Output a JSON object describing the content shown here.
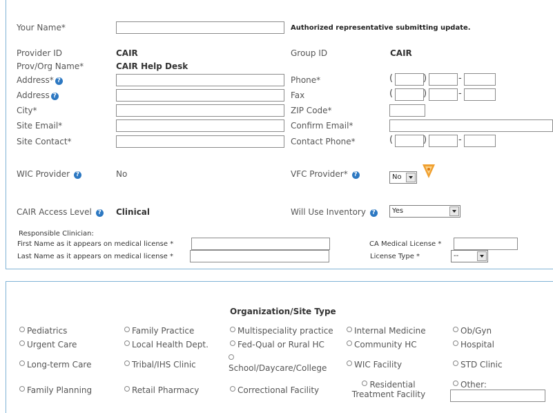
{
  "form": {
    "your_name": {
      "label": "Your Name*",
      "value": "",
      "note": "Authorized representative submitting update."
    },
    "provider_id": {
      "label": "Provider ID",
      "value": "CAIR"
    },
    "group_id": {
      "label": "Group ID",
      "value": "CAIR"
    },
    "prov_org_name": {
      "label": "Prov/Org Name*",
      "value": "CAIR Help Desk"
    },
    "address1": {
      "label": "Address*",
      "value": ""
    },
    "address2": {
      "label": "Address",
      "value": ""
    },
    "city": {
      "label": "City*",
      "value": ""
    },
    "site_email": {
      "label": "Site Email*",
      "value": ""
    },
    "site_contact": {
      "label": "Site Contact*",
      "value": ""
    },
    "phone": {
      "label": "Phone*",
      "open": "(",
      "close": ")",
      "dash": "-"
    },
    "fax": {
      "label": "Fax",
      "open": "(",
      "close": ")",
      "dash": "-"
    },
    "zip": {
      "label": "ZIP Code*",
      "value": ""
    },
    "confirm_email": {
      "label": "Confirm Email*",
      "value": ""
    },
    "contact_phone": {
      "label": "Contact Phone*",
      "open": "(",
      "close": ")",
      "dash": "-"
    },
    "wic_provider": {
      "label": "WIC Provider",
      "value": "No"
    },
    "vfc_provider": {
      "label": "VFC Provider*",
      "selected": "No"
    },
    "cair_access": {
      "label": "CAIR Access Level",
      "value": "Clinical"
    },
    "will_use_inventory": {
      "label": "Will Use Inventory",
      "selected": "Yes"
    },
    "clinician": {
      "heading": "Responsible Clinician:",
      "first_label": "First Name as it appears on medical license",
      "last_label": "Last Name as it appears on medical license",
      "star": "*",
      "license_label": "CA Medical License",
      "license_type_label": "License Type",
      "license_type_selected": "--"
    }
  },
  "help_glyph": "?",
  "vfc_icon": "shield-badge-icon",
  "org_site": {
    "title": "Organization/Site Type",
    "options": [
      "Pediatrics",
      "Family Practice",
      "Multispeciality practice",
      "Internal Medicine",
      "Ob/Gyn",
      "Urgent Care",
      "Local Health Dept.",
      "Fed-Qual or Rural HC",
      "Community HC",
      "Hospital",
      "Long-term Care",
      "Tribal/IHS Clinic",
      "School/Daycare/College",
      "WIC Facility",
      "STD Clinic",
      "Family Planning",
      "Retail Pharmacy",
      "Correctional Facility",
      "Residential Treatment Facility",
      "Other:"
    ],
    "other_value": ""
  },
  "colors": {
    "panel_border": "#7fb2d5",
    "help_icon": "#2c78c2",
    "vfc_icon": "#f0a030"
  }
}
